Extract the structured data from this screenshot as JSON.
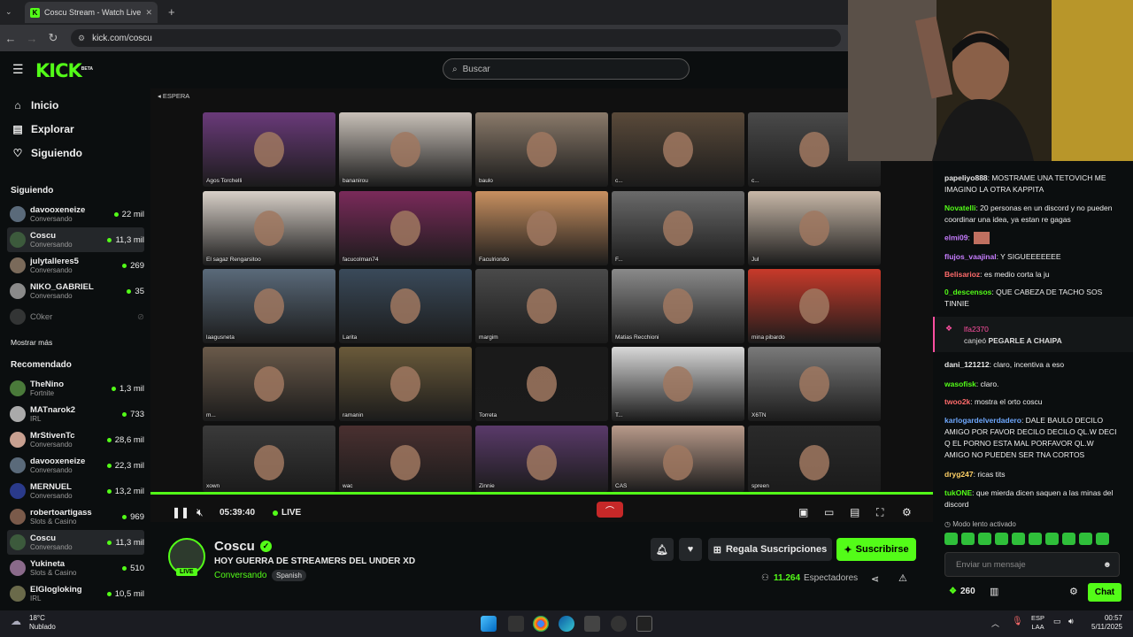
{
  "browser": {
    "tab_title": "Coscu Stream - Watch Live",
    "url": "kick.com/coscu"
  },
  "header": {
    "logo": "KICK",
    "logo_badge": "BETA",
    "search_placeholder": "Buscar"
  },
  "sidebar": {
    "nav": [
      {
        "label": "Inicio",
        "icon": "home-icon"
      },
      {
        "label": "Explorar",
        "icon": "compass-icon"
      },
      {
        "label": "Siguiendo",
        "icon": "heart-icon"
      }
    ],
    "following_title": "Siguiendo",
    "following": [
      {
        "name": "davooxeneize",
        "sub": "Conversando",
        "viewers": "22 mil"
      },
      {
        "name": "Coscu",
        "sub": "Conversando",
        "viewers": "11,3 mil"
      },
      {
        "name": "julytalleres5",
        "sub": "Conversando",
        "viewers": "269"
      },
      {
        "name": "NIKO_GABRIEL",
        "sub": "Conversando",
        "viewers": "35"
      },
      {
        "name": "C0ker",
        "sub": "",
        "viewers": ""
      }
    ],
    "show_more": "Mostrar más",
    "recommended_title": "Recomendado",
    "recommended": [
      {
        "name": "TheNino",
        "sub": "Fortnite",
        "viewers": "1,3 mil"
      },
      {
        "name": "MATnarok2",
        "sub": "IRL",
        "viewers": "733"
      },
      {
        "name": "MrStivenTc",
        "sub": "Conversando",
        "viewers": "28,6 mil"
      },
      {
        "name": "davooxeneize",
        "sub": "Conversando",
        "viewers": "22,3 mil"
      },
      {
        "name": "MERNUEL",
        "sub": "Conversando",
        "viewers": "13,2 mil"
      },
      {
        "name": "robertoartigass",
        "sub": "Slots & Casino",
        "viewers": "969"
      },
      {
        "name": "Coscu",
        "sub": "Conversando",
        "viewers": "11,3 mil"
      },
      {
        "name": "Yukineta",
        "sub": "Slots & Casino",
        "viewers": "510"
      },
      {
        "name": "ElGlogloking",
        "sub": "IRL",
        "viewers": "10,5 mil"
      }
    ]
  },
  "video": {
    "overlay_label": "ESPERA",
    "tiles": [
      "Agos Torchelli",
      "bananirou",
      "baulo",
      "c...",
      "c...",
      "El sagaz Rengarsitoo",
      "facucolman74",
      "Faculriondo",
      "F...",
      "Jul",
      "laagusneta",
      "Larita",
      "margim",
      "Matias Recchioni",
      "mina pibardo",
      "m...",
      "ramanin",
      "Torreta",
      "T...",
      "X6TN",
      "xown",
      "wac",
      "Zinnie",
      "CAS",
      "spreen"
    ],
    "time": "05:39:40",
    "live_label": "LIVE"
  },
  "stream": {
    "name": "Coscu",
    "title": "HOY GUERRA DE STREAMERS DEL UNDER XD",
    "category": "Conversando",
    "language": "Spanish",
    "live_badge": "LIVE",
    "gift_label": "Regala Suscripciones",
    "subscribe_label": "Suscribirse",
    "viewers_count": "11.264",
    "viewers_label": "Espectadores"
  },
  "chat": {
    "messages": [
      {
        "user": "papeliyo888",
        "color": "#e9e9e9",
        "text": "MOSTRAME UNA TETOVICH ME IMAGINO LA OTRA KAPPITA"
      },
      {
        "user": "Novatelli",
        "color": "#53fc18",
        "text": "20 personas en un discord y no pueden coordinar una idea, ya estan re gagas"
      },
      {
        "user": "elmi09",
        "color": "#c77dff",
        "text": ""
      },
      {
        "user": "flujos_vaajinal",
        "color": "#c77dff",
        "text": "Y SIGUEEEEEEE"
      },
      {
        "user": "Belisarioz",
        "color": "#ff6b6b",
        "text": "es medio corta la ju"
      },
      {
        "user": "0_descensos",
        "color": "#53fc18",
        "text": "QUE CABEZA DE TACHO SOS TINNIE"
      },
      {
        "user": "dani_121212",
        "color": "#e9e9e9",
        "text": "claro, incentiva a eso"
      },
      {
        "user": "wasofisk",
        "color": "#53fc18",
        "text": "claro."
      },
      {
        "user": "twoo2k",
        "color": "#ff6b6b",
        "text": "mostra el orto coscu"
      },
      {
        "user": "karlogardelverdadero",
        "color": "#6ea8ff",
        "text": "DALE BAULO DECILO AMIGO POR FAVOR DECILO DECILO QL.W DECI Q EL PORNO ESTA MAL PORFAVOR QL.W AMIGO NO PUEDEN SER TNA CORTOS"
      },
      {
        "user": "dryg247",
        "color": "#ffd166",
        "text": "ricas tits"
      },
      {
        "user": "tukONE",
        "color": "#53fc18",
        "text": "que mierda dicen saquen a las minas del discord"
      }
    ],
    "gift_user": "lfa2370",
    "gift_text": "canjeó",
    "gift_item": "PEGARLE A CHAIPA",
    "slow_mode": "Modo lento activado",
    "input_placeholder": "Enviar un mensaje",
    "points": "260",
    "chat_button": "Chat"
  },
  "taskbar": {
    "weather_temp": "18°C",
    "weather_desc": "Nublado",
    "lang1": "ESP",
    "lang2": "LAA",
    "time": "00:57",
    "date": "5/11/2025"
  }
}
